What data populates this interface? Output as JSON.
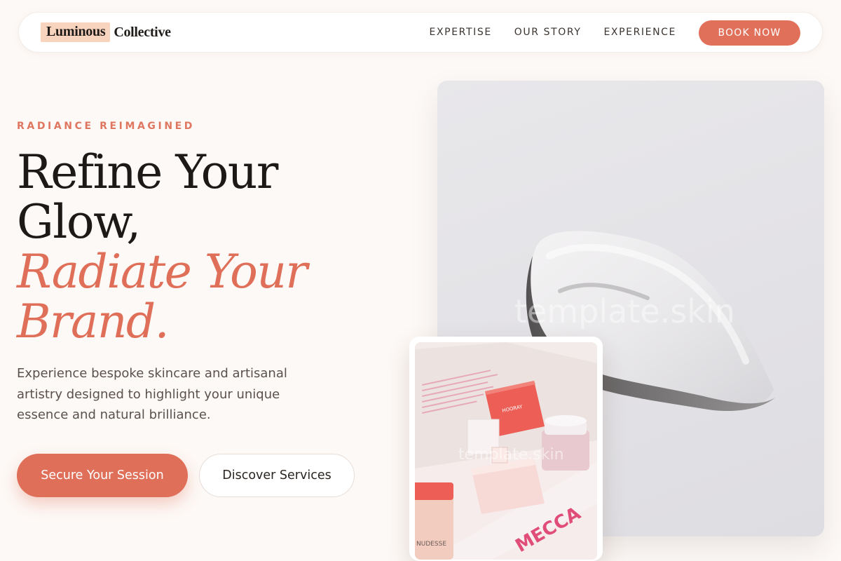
{
  "brand": {
    "highlight": "Luminous",
    "rest": "Collective"
  },
  "nav": {
    "links": [
      "EXPERTISE",
      "OUR STORY",
      "EXPERIENCE"
    ],
    "book_label": "BOOK NOW"
  },
  "hero": {
    "eyebrow": "RADIANCE REIMAGINED",
    "headline_line1": "Refine Your",
    "headline_line2": "Glow,",
    "headline_accent1": "Radiate Your",
    "headline_accent2": "Brand.",
    "lead": "Experience bespoke skincare and artisanal artistry designed to highlight your unique essence and natural brilliance.",
    "primary_cta": "Secure Your Session",
    "secondary_cta": "Discover Services"
  },
  "images": {
    "watermark": "template.skin",
    "product_box_text": "MECCA",
    "jar_label": "NUDESSE",
    "box_label": "HOORAY"
  },
  "colors": {
    "accent": "#df6f58",
    "logo_highlight": "#f8d3bd",
    "background": "#fdf9f6"
  }
}
